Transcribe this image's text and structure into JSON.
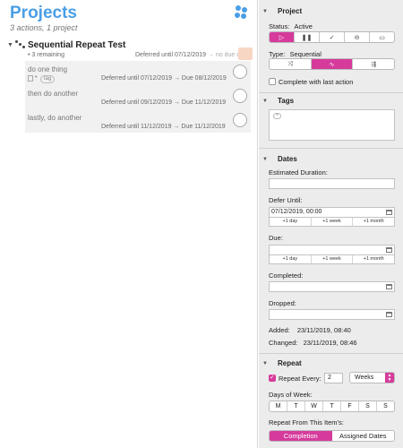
{
  "projects": {
    "title": "Projects",
    "subtitle": "3 actions, 1 project"
  },
  "project_row": {
    "name": "Sequential Repeat Test",
    "remaining": "• 3 remaining",
    "deferred_label": "Deferred until 07/12/2019",
    "due_label": "→  no due date"
  },
  "actions": [
    {
      "name": "do one thing",
      "tag": "tag",
      "meta": "Deferred until 07/12/2019  →  Due 08/12/2019"
    },
    {
      "name": "then do another",
      "meta": "Deferred until 09/12/2019  →  Due 11/12/2019"
    },
    {
      "name": "lastly, do another",
      "meta": "Deferred until 11/12/2019  →  Due 11/12/2019"
    }
  ],
  "inspector": {
    "project_section": {
      "title": "Project",
      "status_label": "Status:",
      "status_value": "Active",
      "status_icons": [
        "play-icon",
        "pause-icon",
        "check-icon",
        "dropped-icon",
        "folder-icon"
      ],
      "type_label": "Type:",
      "type_value": "Sequential",
      "type_icons": [
        "parallel-icon",
        "sequential-icon",
        "single-actions-icon"
      ],
      "complete_with_last": "Complete with last action"
    },
    "tags_section": {
      "title": "Tags",
      "add_symbol": "+"
    },
    "dates_section": {
      "title": "Dates",
      "estimated_duration_label": "Estimated Duration:",
      "estimated_duration_value": "",
      "defer_label": "Defer Until:",
      "defer_value": "07/12/2019, 00:00",
      "due_label": "Due:",
      "due_value": "",
      "completed_label": "Completed:",
      "completed_value": "",
      "dropped_label": "Dropped:",
      "dropped_value": "",
      "quick_buttons": [
        "+1 day",
        "+1 week",
        "+1 month"
      ],
      "added_label": "Added:",
      "added_value": "23/11/2019, 08:40",
      "changed_label": "Changed:",
      "changed_value": "23/11/2019, 08:46"
    },
    "repeat_section": {
      "title": "Repeat",
      "repeat_every_label": "Repeat Every:",
      "repeat_every_value": "2",
      "repeat_unit": "Weeks",
      "days_of_week_label": "Days of Week:",
      "days": [
        "M",
        "T",
        "W",
        "T",
        "F",
        "S",
        "S"
      ],
      "repeat_from_label": "Repeat From This Item's:",
      "repeat_from_options": [
        "Completion",
        "Assigned Dates"
      ],
      "repeat_from_selected": "Completion"
    }
  },
  "colors": {
    "accent": "#d63b9c",
    "title_blue": "#4a9ee6",
    "inspector_bg": "#ececec"
  }
}
